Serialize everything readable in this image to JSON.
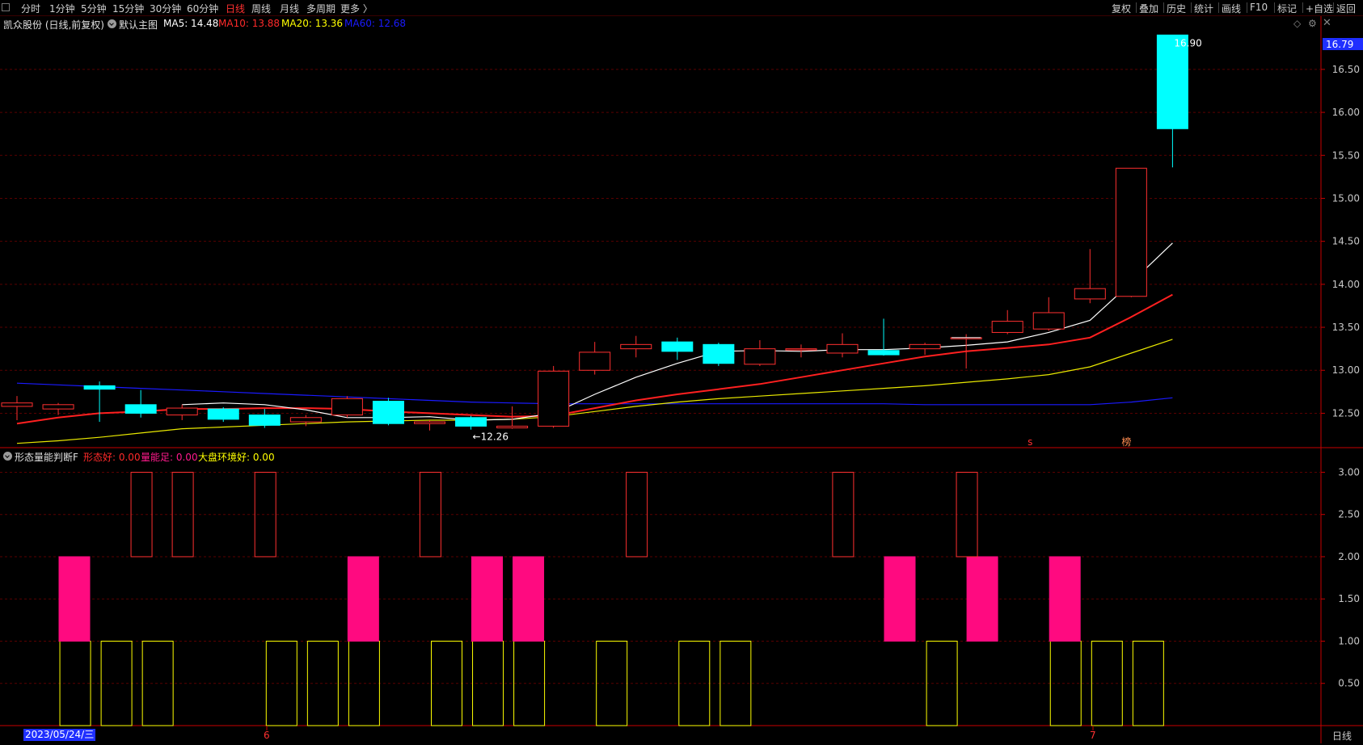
{
  "toolbar": {
    "periods": [
      "分时",
      "1分钟",
      "5分钟",
      "15分钟",
      "30分钟",
      "60分钟",
      "日线",
      "周线",
      "月线",
      "多周期",
      "更多 〉"
    ],
    "active_period": "日线",
    "tools": [
      "复权",
      "叠加",
      "历史",
      "统计",
      "画线",
      "F10",
      "标记",
      "+自选",
      "返回"
    ]
  },
  "main_panel": {
    "title": "凯众股份 (日线,前复权)",
    "indicator_name": "默认主图",
    "ma": [
      {
        "label": "MA5: 14.48",
        "color": "#ffffff"
      },
      {
        "label": "MA10: 13.88",
        "color": "#ff2a2a"
      },
      {
        "label": "MA20: 13.36",
        "color": "#ffff00"
      },
      {
        "label": "MA60: 12.68",
        "color": "#1a1aff"
      }
    ],
    "last_price_tag": "16.79",
    "high_label": "16.90",
    "low_label": "←12.26",
    "markers": [
      "s",
      "榜"
    ]
  },
  "sub_panel": {
    "title": "形态量能判断F",
    "indicators": [
      {
        "label": "形态好: 0.00",
        "color": "#ff2a2a"
      },
      {
        "label": "量能足: 0.00",
        "color": "#ff1a8c"
      },
      {
        "label": "大盘环境好: 0.00",
        "color": "#ffff00"
      }
    ]
  },
  "x_axis": {
    "date_label": "2023/05/24/三",
    "month_labels": [
      "6",
      "7"
    ],
    "right_label": "日线"
  },
  "colors": {
    "up": "#ff3030",
    "down": "#00ffff",
    "ma5": "#ffffff",
    "ma10": "#ff2020",
    "ma20": "#e8e800",
    "ma60": "#1a1aff",
    "grid": "#5a0000",
    "axis": "#c80000",
    "pink": "#ff0a80",
    "yellow": "#ffff00"
  },
  "chart_data": [
    {
      "type": "candlestick",
      "y_ticks": [
        12.5,
        13.0,
        13.5,
        14.0,
        14.5,
        15.0,
        15.5,
        16.0,
        16.5
      ],
      "ylim": [
        12.1,
        16.95
      ],
      "candles": [
        {
          "o": 12.58,
          "h": 12.7,
          "l": 12.42,
          "c": 12.62
        },
        {
          "o": 12.55,
          "h": 12.62,
          "l": 12.48,
          "c": 12.6
        },
        {
          "o": 12.82,
          "h": 12.87,
          "l": 12.4,
          "c": 12.78
        },
        {
          "o": 12.6,
          "h": 12.77,
          "l": 12.45,
          "c": 12.5
        },
        {
          "o": 12.48,
          "h": 12.6,
          "l": 12.42,
          "c": 12.56
        },
        {
          "o": 12.55,
          "h": 12.57,
          "l": 12.4,
          "c": 12.43
        },
        {
          "o": 12.48,
          "h": 12.55,
          "l": 12.33,
          "c": 12.36
        },
        {
          "o": 12.4,
          "h": 12.48,
          "l": 12.35,
          "c": 12.45
        },
        {
          "o": 12.48,
          "h": 12.7,
          "l": 12.45,
          "c": 12.67
        },
        {
          "o": 12.64,
          "h": 12.68,
          "l": 12.36,
          "c": 12.38
        },
        {
          "o": 12.38,
          "h": 12.42,
          "l": 12.3,
          "c": 12.4
        },
        {
          "o": 12.45,
          "h": 12.47,
          "l": 12.31,
          "c": 12.35
        },
        {
          "o": 12.33,
          "h": 12.58,
          "l": 12.32,
          "c": 12.35
        },
        {
          "o": 12.35,
          "h": 13.05,
          "l": 12.33,
          "c": 12.99
        },
        {
          "o": 13.0,
          "h": 13.33,
          "l": 12.95,
          "c": 13.21
        },
        {
          "o": 13.25,
          "h": 13.4,
          "l": 13.15,
          "c": 13.3
        },
        {
          "o": 13.33,
          "h": 13.38,
          "l": 13.12,
          "c": 13.22
        },
        {
          "o": 13.3,
          "h": 13.32,
          "l": 13.05,
          "c": 13.08
        },
        {
          "o": 13.07,
          "h": 13.35,
          "l": 13.05,
          "c": 13.25
        },
        {
          "o": 13.24,
          "h": 13.3,
          "l": 13.15,
          "c": 13.25
        },
        {
          "o": 13.2,
          "h": 13.43,
          "l": 13.15,
          "c": 13.3
        },
        {
          "o": 13.23,
          "h": 13.6,
          "l": 13.17,
          "c": 13.18
        },
        {
          "o": 13.25,
          "h": 13.32,
          "l": 13.18,
          "c": 13.3
        },
        {
          "o": 13.38,
          "h": 13.42,
          "l": 13.02,
          "c": 13.38
        },
        {
          "o": 13.44,
          "h": 13.7,
          "l": 13.42,
          "c": 13.57
        },
        {
          "o": 13.48,
          "h": 13.85,
          "l": 13.46,
          "c": 13.67
        },
        {
          "o": 13.83,
          "h": 14.41,
          "l": 13.78,
          "c": 13.95
        },
        {
          "o": 13.86,
          "h": 15.35,
          "l": 13.85,
          "c": 15.35
        },
        {
          "o": 16.9,
          "h": 16.9,
          "l": 15.36,
          "c": 15.81
        }
      ],
      "ma5": [
        null,
        null,
        null,
        null,
        12.6,
        12.62,
        12.6,
        12.54,
        12.45,
        12.45,
        12.46,
        12.42,
        12.43,
        12.5,
        12.72,
        12.92,
        13.08,
        13.22,
        13.23,
        13.22,
        13.24,
        13.24,
        13.26,
        13.29,
        13.33,
        13.44,
        13.58,
        14.02,
        14.48
      ],
      "ma10": [
        12.38,
        12.45,
        12.5,
        12.52,
        12.55,
        12.55,
        12.56,
        12.56,
        12.55,
        12.52,
        12.5,
        12.48,
        12.46,
        12.47,
        12.56,
        12.65,
        12.72,
        12.78,
        12.84,
        12.92,
        13.0,
        13.08,
        13.16,
        13.22,
        13.26,
        13.3,
        13.38,
        13.62,
        13.88
      ],
      "ma20": [
        12.15,
        12.18,
        12.22,
        12.27,
        12.32,
        12.34,
        12.36,
        12.38,
        12.4,
        12.41,
        12.42,
        12.42,
        12.43,
        12.46,
        12.52,
        12.58,
        12.63,
        12.67,
        12.7,
        12.73,
        12.76,
        12.79,
        12.82,
        12.86,
        12.9,
        12.95,
        13.04,
        13.2,
        13.36
      ],
      "ma60": [
        12.85,
        12.83,
        12.81,
        12.79,
        12.77,
        12.75,
        12.73,
        12.71,
        12.69,
        12.67,
        12.65,
        12.63,
        12.62,
        12.61,
        12.61,
        12.61,
        12.61,
        12.61,
        12.61,
        12.61,
        12.61,
        12.61,
        12.6,
        12.6,
        12.6,
        12.6,
        12.6,
        12.63,
        12.68
      ]
    },
    {
      "type": "bar",
      "y_ticks": [
        0.5,
        1.0,
        1.5,
        2.0,
        2.5,
        3.0
      ],
      "ylim": [
        0,
        3.1
      ],
      "xing_tai_hao": [
        0,
        1,
        1,
        0,
        1,
        0,
        0,
        0,
        1,
        0,
        0,
        0,
        0,
        1,
        0,
        0,
        0,
        0,
        1,
        0,
        0,
        1,
        0,
        0,
        0,
        0,
        0,
        0,
        0
      ],
      "liang_neng_zu": [
        1,
        0,
        0,
        0,
        0,
        0,
        0,
        1,
        0,
        0,
        1,
        1,
        0,
        0,
        0,
        0,
        0,
        0,
        0,
        0,
        1,
        0,
        1,
        0,
        1,
        0,
        0,
        0,
        0
      ],
      "da_pan_huan_jing_hao": [
        0,
        1,
        1,
        1,
        0,
        0,
        1,
        1,
        1,
        0,
        1,
        1,
        1,
        0,
        1,
        0,
        1,
        1,
        0,
        0,
        0,
        0,
        1,
        0,
        0,
        1,
        1,
        1,
        0
      ]
    }
  ]
}
